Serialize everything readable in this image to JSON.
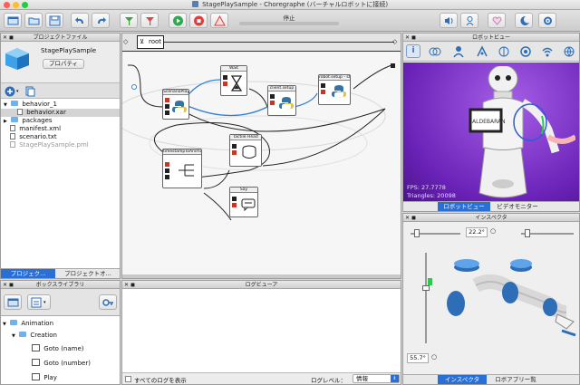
{
  "window": {
    "title": "StagePlaySample - Choregraphe (バーチャルロボットに接続)"
  },
  "toolbar": {
    "status": "停止",
    "buttons": [
      "new-project",
      "open-project",
      "save-project",
      "undo",
      "redo",
      "connect",
      "disconnect",
      "play",
      "stop",
      "debug",
      "volume",
      "animation-mode",
      "heart",
      "sleep",
      "settings"
    ]
  },
  "project_files": {
    "header": "プロジェクトファイル",
    "project_name": "StagePlaySample",
    "properties_button": "プロパティ",
    "tree": [
      {
        "label": "behavior_1",
        "level": 0,
        "type": "folder"
      },
      {
        "label": "behavior.xar",
        "level": 1,
        "type": "file",
        "selected": true
      },
      {
        "label": "packages",
        "level": 0,
        "type": "folder"
      },
      {
        "label": "manifest.xml",
        "level": 0,
        "type": "file"
      },
      {
        "label": "scenario.txt",
        "level": 0,
        "type": "file"
      },
      {
        "label": "StagePlaySample.pml",
        "level": 0,
        "type": "file",
        "dim": true
      }
    ],
    "tabs": [
      "プロジェク...",
      "プロジェクトオ..."
    ]
  },
  "flow": {
    "breadcrumb": "root",
    "boxes": {
      "scenario": "ScenarioPlayer",
      "wait": "Wait",
      "client": "client.setup",
      "setup": "robot.setup - start fo",
      "timeline": "timestampToAnimation",
      "tactile": "Tactile Head",
      "say": "Say"
    }
  },
  "robot_view": {
    "header": "ロボットビュー",
    "fps": "FPS: 27.7778",
    "triangles": "Triangles: 20098",
    "tabs": [
      "ロボットビュー",
      "ビデオモニター"
    ],
    "tablet_text": "ALDEBARAN"
  },
  "inspector": {
    "header": "インスペクタ",
    "top_angle": "22.2°",
    "left_angle": "55.7°",
    "tabs": [
      "インスペクタ",
      "ロボアプリー覧"
    ]
  },
  "box_library": {
    "header": "ボックスライブラリ",
    "tree": [
      {
        "label": "Animation",
        "level": 0
      },
      {
        "label": "Creation",
        "level": 1
      },
      {
        "label": "Goto (name)",
        "level": 2
      },
      {
        "label": "Goto (number)",
        "level": 2
      },
      {
        "label": "Play",
        "level": 2
      }
    ]
  },
  "log_viewer": {
    "header": "ログビューア",
    "show_all": "すべてのログを表示",
    "level_label": "ログレベル：",
    "level_value": "情報"
  },
  "colors": {
    "accent": "#2a6fd6",
    "robot_bg": "#7b2ac8",
    "link": "#2d7fd4"
  }
}
